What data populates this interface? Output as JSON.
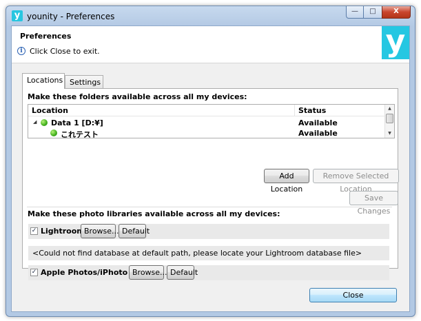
{
  "window": {
    "title": "younity - Preferences",
    "app_icon": "y",
    "controls": {
      "minimize": "—",
      "maximize": "□",
      "close": "X"
    }
  },
  "header": {
    "title": "Preferences",
    "subtitle": "Click Close to exit.",
    "logo_text": "y",
    "logo_color": "#25c7e2"
  },
  "tabs": [
    {
      "label": "Locations",
      "active": true
    },
    {
      "label": "Settings",
      "active": false
    }
  ],
  "locations": {
    "section_title": "Make these folders available across all my devices:",
    "columns": {
      "location": "Location",
      "status": "Status"
    },
    "rows": [
      {
        "name": "Data 1  [D:¥]",
        "status": "Available",
        "expanded": true
      },
      {
        "name": "これテスト",
        "status": "Available"
      }
    ],
    "add_label": "Add Location",
    "remove_label": "Remove Selected Location",
    "save_label": "Save Changes"
  },
  "libraries": {
    "section_title": "Make these photo libraries available across all my devices:",
    "lightroom": {
      "label": "Lightroom",
      "checked": true,
      "browse_label": "Browse...",
      "default_label": "Default",
      "note": "<Could not find database at default path, please locate your Lightroom database file>"
    },
    "apple": {
      "label": "Apple Photos/iPhoto",
      "checked": true,
      "browse_label": "Browse...",
      "default_label": "Default"
    }
  },
  "footer": {
    "close_label": "Close"
  }
}
